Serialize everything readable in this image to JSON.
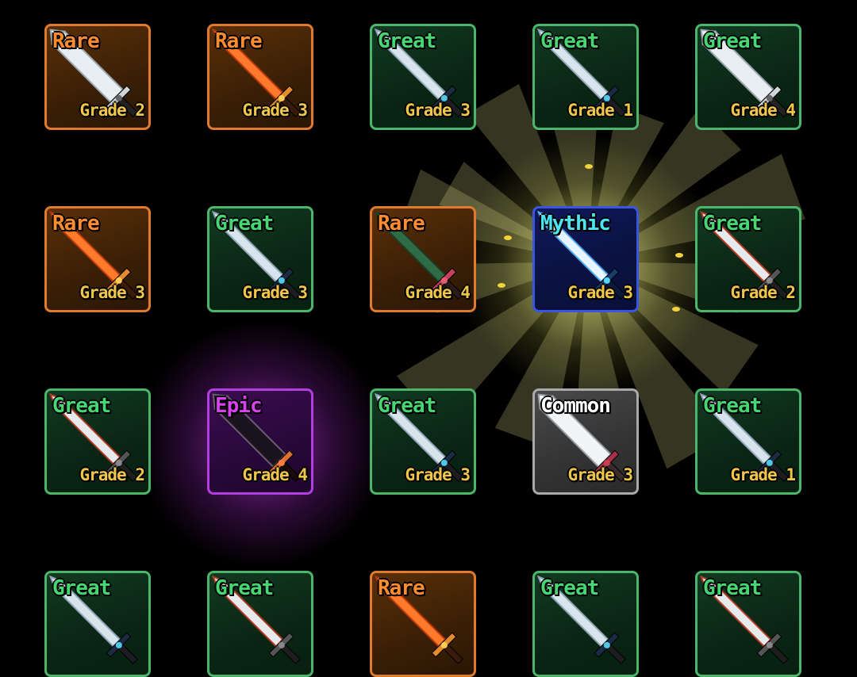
{
  "rarity_colors": {
    "Great": "#46d773",
    "Rare": "#ff8c2e",
    "Mythic": "#4be6f0",
    "Epic": "#d840f0",
    "Common": "#ffffff"
  },
  "items": [
    {
      "rarity": "Rare",
      "grade": "Grade 2",
      "weapon": "steel-greatsword-icon"
    },
    {
      "rarity": "Rare",
      "grade": "Grade 3",
      "weapon": "flame-scimitar-icon"
    },
    {
      "rarity": "Great",
      "grade": "Grade 3",
      "weapon": "steel-longsword-icon"
    },
    {
      "rarity": "Great",
      "grade": "Grade 1",
      "weapon": "steel-longsword-icon"
    },
    {
      "rarity": "Great",
      "grade": "Grade 4",
      "weapon": "steel-greatsword-icon"
    },
    {
      "rarity": "Rare",
      "grade": "Grade 3",
      "weapon": "flame-scimitar-icon"
    },
    {
      "rarity": "Great",
      "grade": "Grade 3",
      "weapon": "steel-longsword-icon"
    },
    {
      "rarity": "Rare",
      "grade": "Grade 4",
      "weapon": "vine-sword-icon"
    },
    {
      "rarity": "Mythic",
      "grade": "Grade 3",
      "weapon": "ice-blade-icon"
    },
    {
      "rarity": "Great",
      "grade": "Grade 2",
      "weapon": "bloody-sword-icon"
    },
    {
      "rarity": "Great",
      "grade": "Grade 2",
      "weapon": "bloody-sword-icon"
    },
    {
      "rarity": "Epic",
      "grade": "Grade 4",
      "weapon": "dark-greatsword-icon"
    },
    {
      "rarity": "Great",
      "grade": "Grade 3",
      "weapon": "steel-longsword-icon"
    },
    {
      "rarity": "Common",
      "grade": "Grade 3",
      "weapon": "broadsword-icon"
    },
    {
      "rarity": "Great",
      "grade": "Grade 1",
      "weapon": "steel-longsword-icon"
    },
    {
      "rarity": "Great",
      "grade": "",
      "weapon": "steel-longsword-icon"
    },
    {
      "rarity": "Great",
      "grade": "",
      "weapon": "bloody-sword-icon"
    },
    {
      "rarity": "Rare",
      "grade": "",
      "weapon": "flame-scimitar-icon"
    },
    {
      "rarity": "Great",
      "grade": "",
      "weapon": "steel-longsword-icon"
    },
    {
      "rarity": "Great",
      "grade": "",
      "weapon": "bloody-sword-icon"
    }
  ]
}
